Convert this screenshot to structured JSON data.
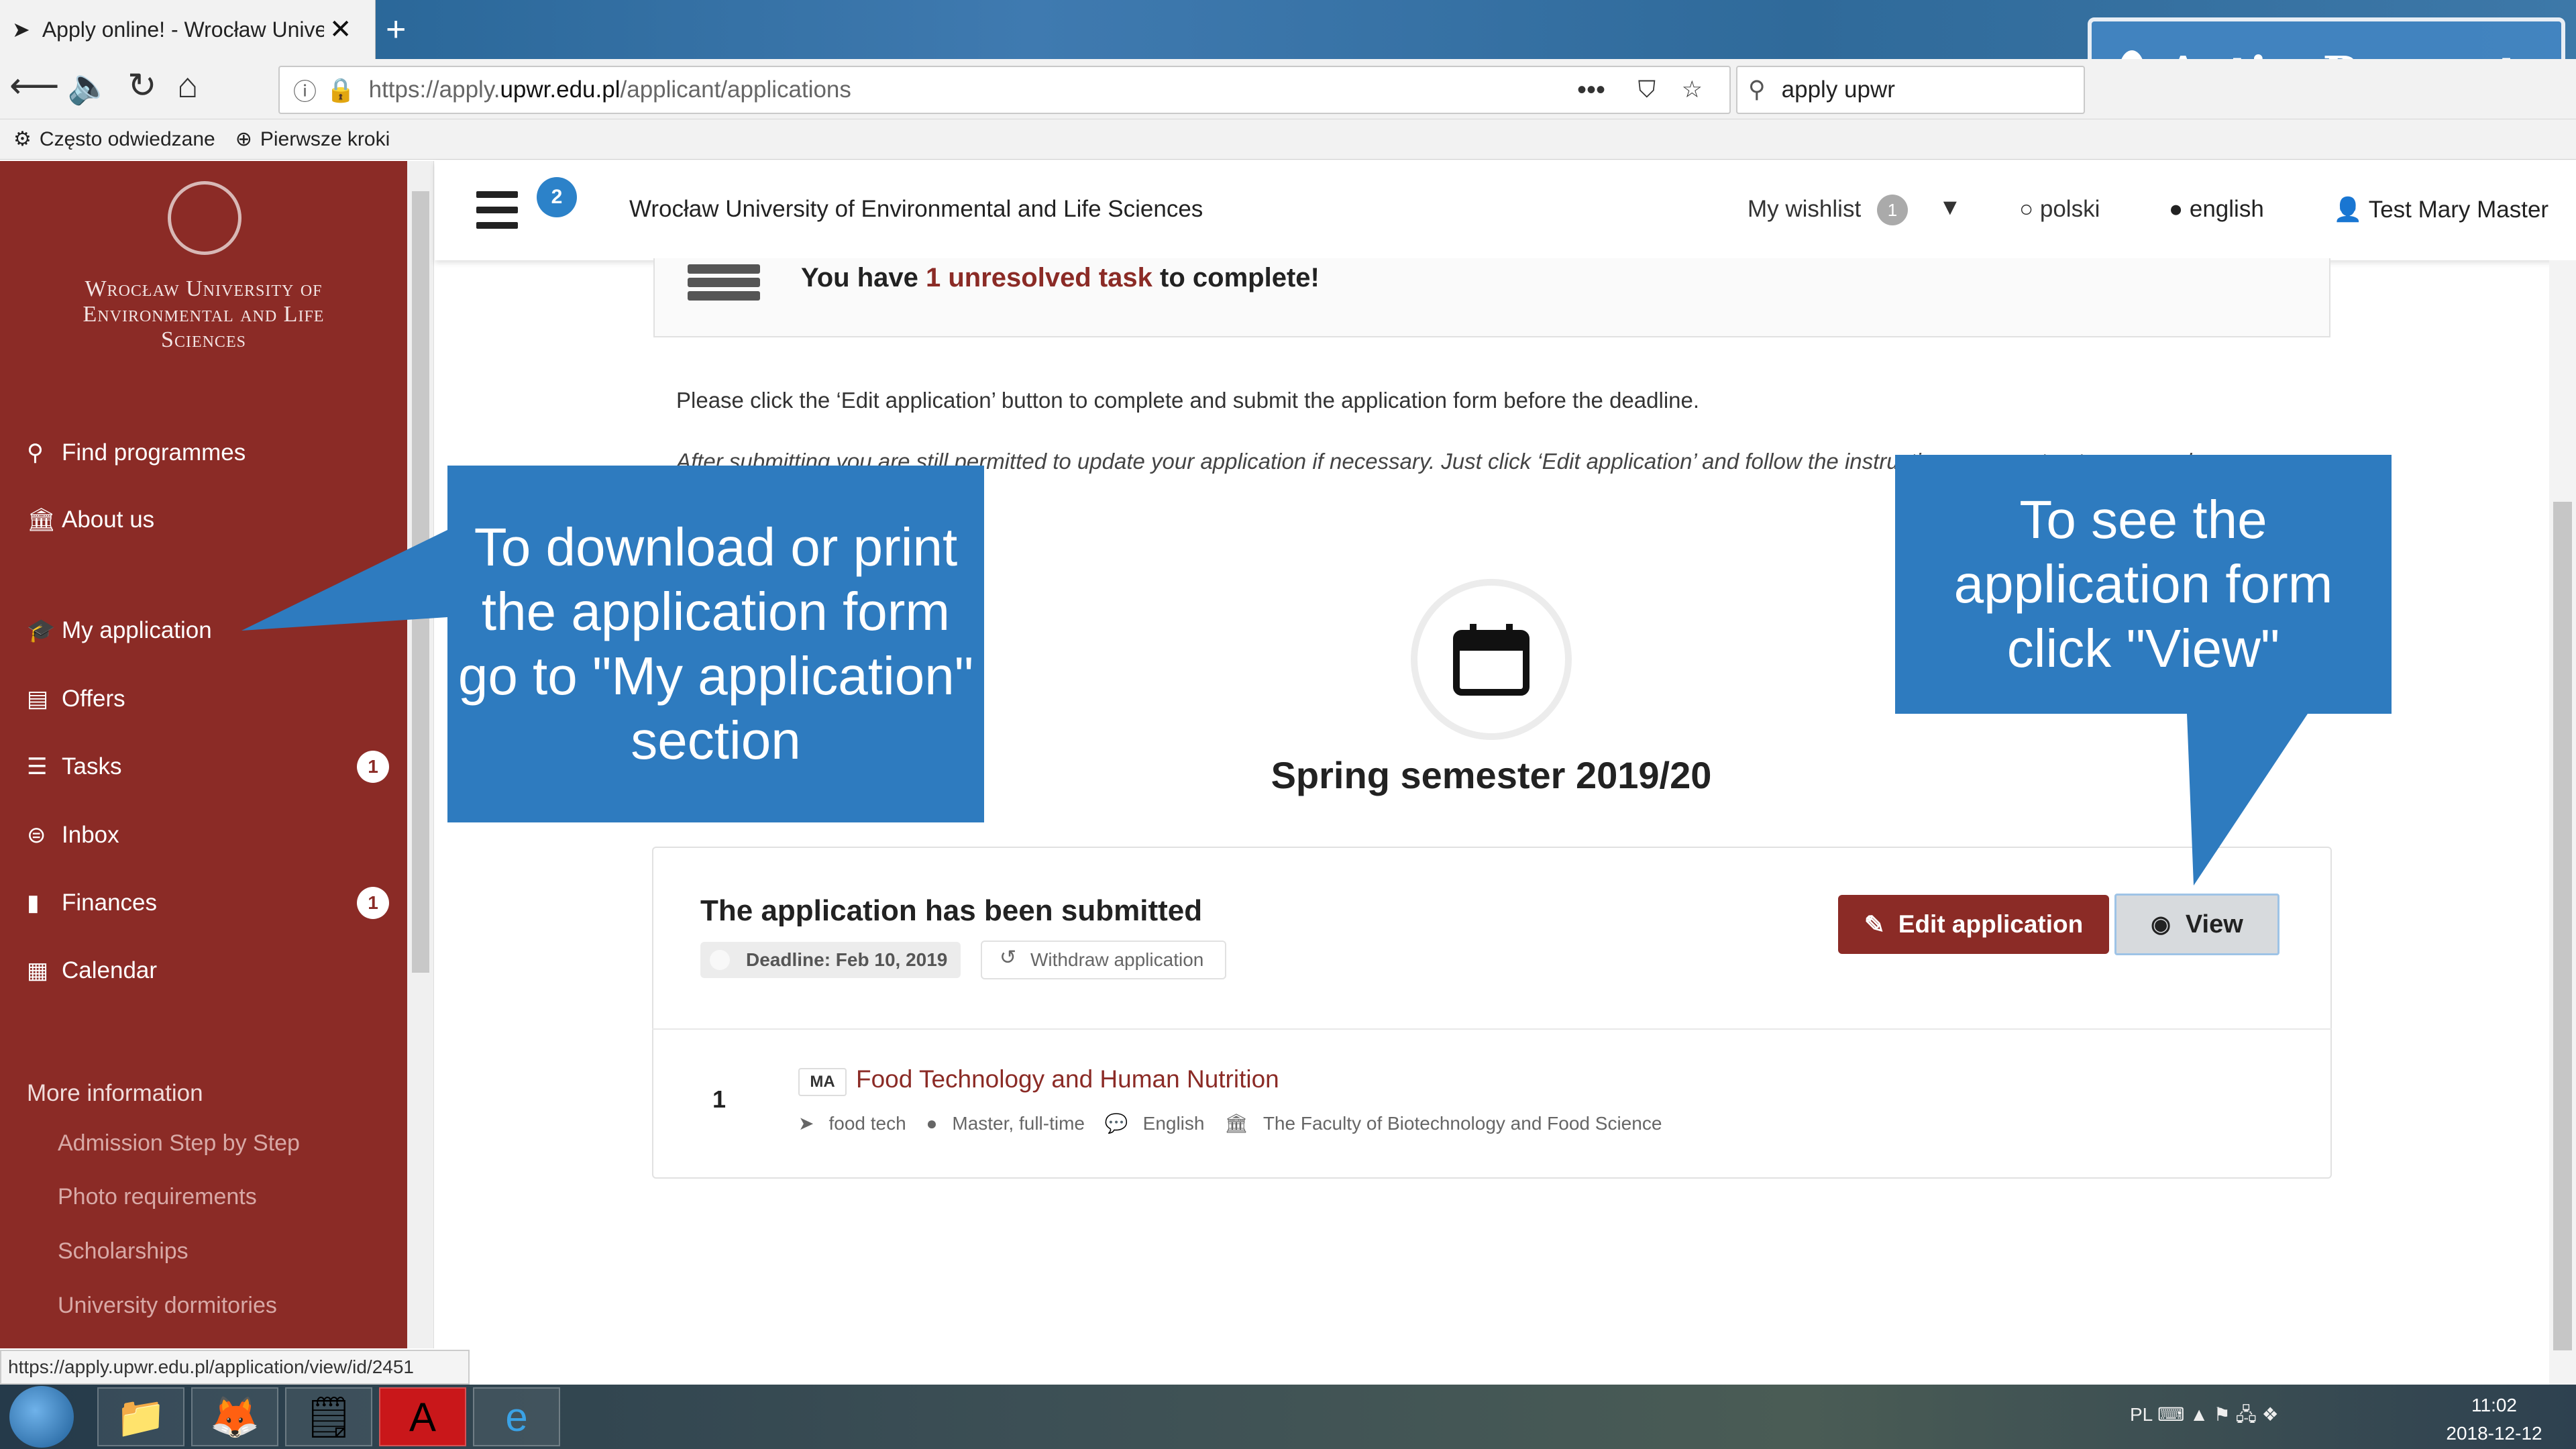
{
  "browser": {
    "tab_title": "Apply online! - Wrocław Univer",
    "url_prefix": "https://apply.",
    "url_domain": "upwr.edu.pl",
    "url_path": "/applicant/applications",
    "search_value": "apply upwr",
    "bookmarks": [
      "Często odwiedzane",
      "Pierwsze kroki"
    ],
    "status_url": "https://apply.upwr.edu.pl/application/view/id/2451"
  },
  "watermark": {
    "text": "ActivePresenter"
  },
  "sidebar": {
    "university": "Wrocław University of Environmental and Life Sciences",
    "items": [
      {
        "label": "Find programmes",
        "icon": "search-icon"
      },
      {
        "label": "About us",
        "icon": "institution-icon"
      },
      {
        "label": "My application",
        "icon": "graduation-cap-icon"
      },
      {
        "label": "Offers",
        "icon": "document-icon"
      },
      {
        "label": "Tasks",
        "icon": "tasks-icon",
        "badge": "1"
      },
      {
        "label": "Inbox",
        "icon": "inbox-icon"
      },
      {
        "label": "Finances",
        "icon": "file-icon",
        "badge": "1"
      },
      {
        "label": "Calendar",
        "icon": "calendar-icon"
      }
    ],
    "more_info_title": "More information",
    "more_info": [
      "Admission Step by Step",
      "Photo requirements",
      "Scholarships",
      "University dormitories"
    ]
  },
  "header": {
    "menu_badge": "2",
    "title": "Wrocław University of Environmental and Life Sciences",
    "wishlist_label": "My wishlist",
    "wishlist_count": "1",
    "lang_pl": "polski",
    "lang_en": "english",
    "user": "Test Mary Master"
  },
  "task_banner": {
    "pre": "You have ",
    "count": "1 unresolved task",
    "post": " to complete!"
  },
  "content": {
    "instruction": "Please click the ‘Edit application’ button to complete and submit the application form before the deadline.",
    "note": "After submitting you are still permitted to update your application if necessary. Just click ‘Edit application’ and follow the instructi… n may not get processed.",
    "semester": "Spring semester 2019/20"
  },
  "application": {
    "status": "The application has been submitted",
    "deadline": "Deadline: Feb 10, 2019",
    "withdraw": "Withdraw application",
    "edit_label": "Edit application",
    "view_label": "View",
    "programme": {
      "index": "1",
      "level": "MA",
      "name": "Food Technology and Human Nutrition",
      "tag": "food tech",
      "mode": "Master, full-time",
      "language": "English",
      "faculty": "The Faculty of Biotechnology and Food Science"
    }
  },
  "callouts": {
    "left": "To download or print the application form go to \"My application\" section",
    "right": "To see the application form click \"View\""
  },
  "taskbar": {
    "lang": "PL",
    "time": "11:02",
    "date": "2018-12-12"
  }
}
